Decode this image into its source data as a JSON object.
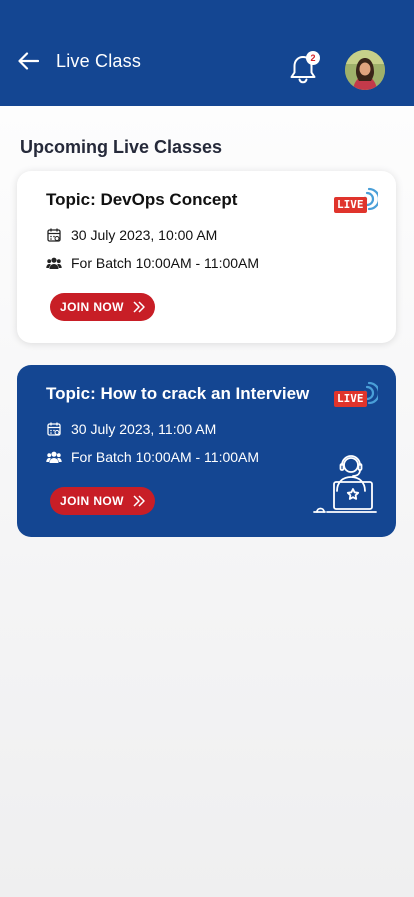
{
  "header": {
    "title": "Live Class",
    "notification_count": "2"
  },
  "section": {
    "title": "Upcoming Live Classes"
  },
  "classes": [
    {
      "topic": "Topic: DevOps Concept",
      "datetime": "30 July 2023, 10:00 AM",
      "batch": "For Batch 10:00AM - 11:00AM",
      "join_label": "JOIN NOW",
      "live_label": "LIVE"
    },
    {
      "topic": "Topic: How to crack an Interview",
      "datetime": "30 July 2023, 11:00 AM",
      "batch": "For Batch 10:00AM - 11:00AM",
      "join_label": "JOIN NOW",
      "live_label": "LIVE"
    }
  ],
  "colors": {
    "primary": "#144692",
    "accent_red": "#c81e26",
    "live_red": "#e0342c",
    "wave_blue": "#4a9fd8"
  },
  "icons": [
    "back-arrow-icon",
    "bell-icon",
    "calendar-icon",
    "group-icon",
    "double-chevron-right-icon",
    "live-broadcast-icon",
    "support-agent-laptop-icon"
  ]
}
